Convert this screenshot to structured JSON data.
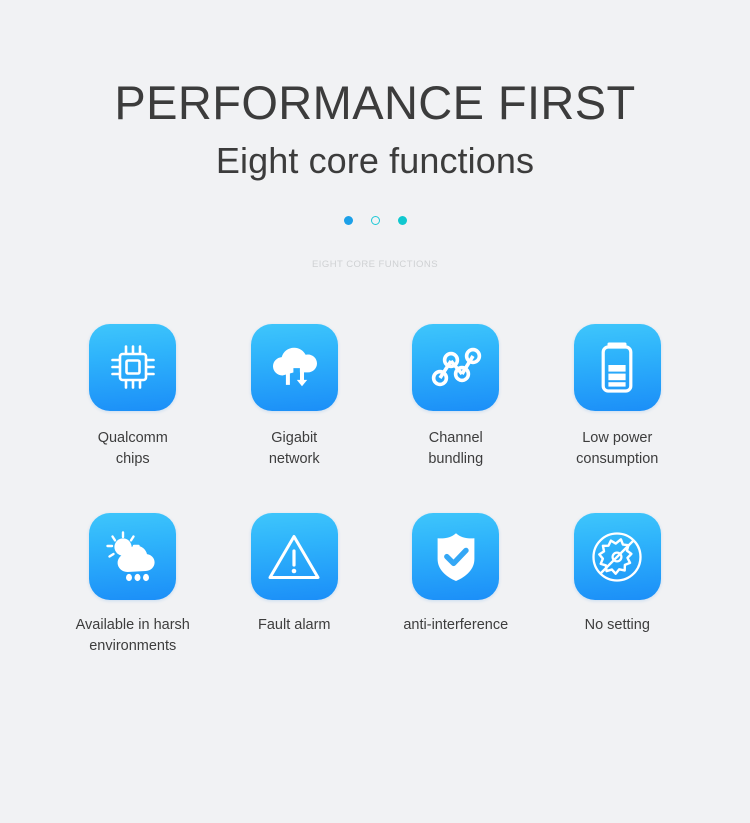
{
  "header": {
    "title": "PERFORMANCE FIRST",
    "subtitle": "Eight core functions"
  },
  "pagination": {
    "dots": [
      {
        "name": "dot-1",
        "state": "filled",
        "color": "#1ca0e8"
      },
      {
        "name": "dot-2",
        "state": "hollow",
        "color": "#1fc8d6"
      },
      {
        "name": "dot-3",
        "state": "filled",
        "color": "#10c8cf"
      }
    ]
  },
  "caption": "EIGHT CORE FUNCTIONS",
  "theme": {
    "background": "#f1f2f4",
    "tile_gradient_top": "#3fc6fb",
    "tile_gradient_bottom": "#1b8ef8",
    "text_color": "#3d3d3d",
    "caption_color": "#cfd1d3"
  },
  "features": [
    {
      "icon": "cpu-chip-icon",
      "label": "Qualcomm\nchips"
    },
    {
      "icon": "cloud-network-icon",
      "label": "Gigabit\nnetwork"
    },
    {
      "icon": "node-graph-icon",
      "label": "Channel\nbundling"
    },
    {
      "icon": "battery-icon",
      "label": "Low power\nconsumption"
    },
    {
      "icon": "sun-cloud-rain-icon",
      "label": "Available in harsh\nenvironments"
    },
    {
      "icon": "warning-triangle-icon",
      "label": "Fault alarm"
    },
    {
      "icon": "shield-check-icon",
      "label": "anti-interference"
    },
    {
      "icon": "gear-no-setting-icon",
      "label": "No setting"
    }
  ]
}
